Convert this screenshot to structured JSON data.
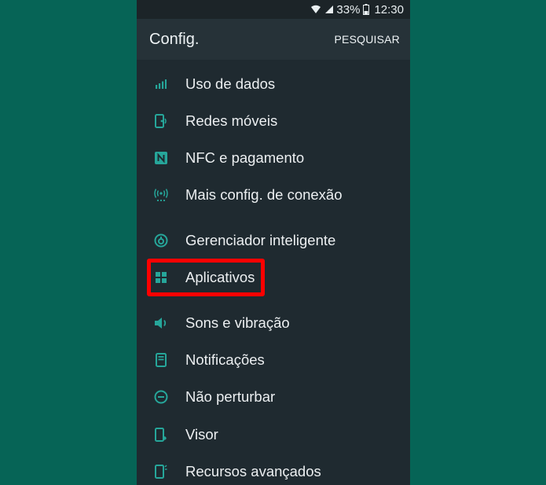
{
  "status_bar": {
    "battery": "33%",
    "time": "12:30"
  },
  "app_bar": {
    "title": "Config.",
    "search_label": "PESQUISAR"
  },
  "accent_color": "#26a69a",
  "highlight_color": "#ff0000",
  "settings": [
    {
      "label": "Uso de dados",
      "icon": "data-usage-icon"
    },
    {
      "label": "Redes móveis",
      "icon": "mobile-networks-icon"
    },
    {
      "label": "NFC e pagamento",
      "icon": "nfc-icon"
    },
    {
      "label": "Mais config. de conexão",
      "icon": "more-connection-icon"
    },
    {
      "label": "Gerenciador inteligente",
      "icon": "smart-manager-icon"
    },
    {
      "label": "Aplicativos",
      "icon": "apps-icon"
    },
    {
      "label": "Sons e vibração",
      "icon": "sound-icon"
    },
    {
      "label": "Notificações",
      "icon": "notifications-icon"
    },
    {
      "label": "Não perturbar",
      "icon": "do-not-disturb-icon"
    },
    {
      "label": "Visor",
      "icon": "display-icon"
    },
    {
      "label": "Recursos avançados",
      "icon": "advanced-features-icon"
    }
  ]
}
